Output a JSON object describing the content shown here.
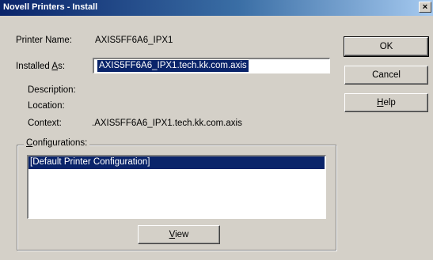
{
  "window": {
    "title": "Novell Printers - Install",
    "close_glyph": "×"
  },
  "fields": {
    "printer_name": {
      "label": "Printer Name:",
      "value": "AXIS5FF6A6_IPX1"
    },
    "installed_as": {
      "label_pre": "Installed ",
      "label_accel": "A",
      "label_post": "s:",
      "value": "AXIS5FF6A6_IPX1.tech.kk.com.axis"
    },
    "description": {
      "label": "Description:",
      "value": ""
    },
    "location": {
      "label": "Location:",
      "value": ""
    },
    "context": {
      "label": "Context:",
      "value": ".AXIS5FF6A6_IPX1.tech.kk.com.axis"
    }
  },
  "buttons": {
    "ok": "OK",
    "cancel": "Cancel",
    "help_accel": "H",
    "help_rest": "elp",
    "view_accel": "V",
    "view_rest": "iew"
  },
  "configurations": {
    "label_accel": "C",
    "label_rest": "onfigurations:",
    "items": [
      "[Default Printer Configuration]"
    ],
    "selected_index": 0
  }
}
